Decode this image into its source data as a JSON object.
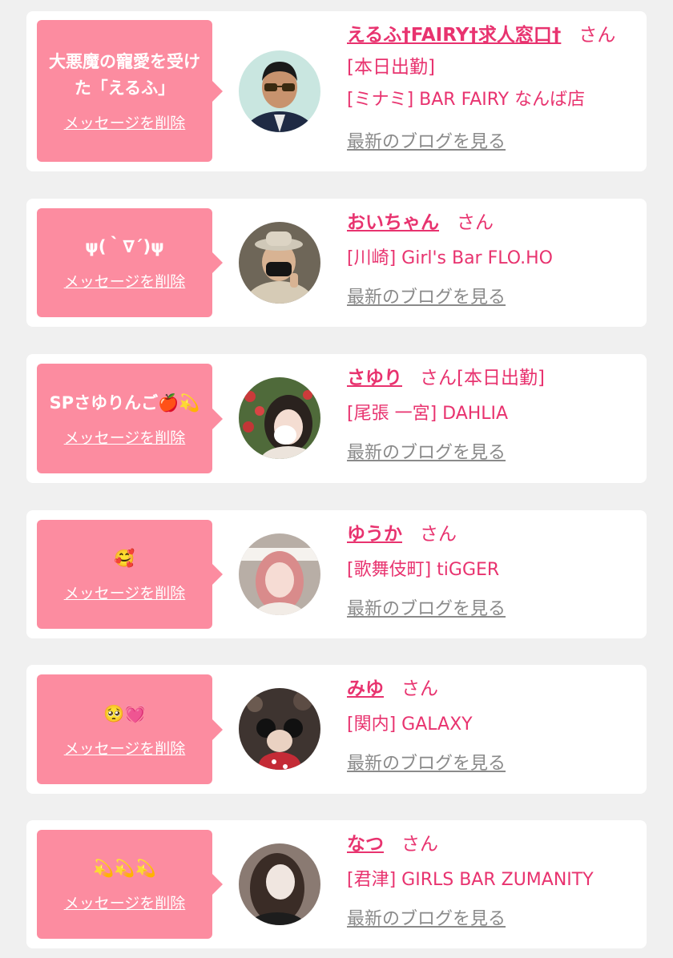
{
  "cards": [
    {
      "message": "大悪魔の寵愛を受けた「えるふ」",
      "delete_label": "メッセージを削除",
      "name": "えるふ†FAIRY†求人窓口†",
      "suffix": "さん[本日出勤]",
      "shop": "[ミナミ] BAR FAIRY なんば店",
      "blog_label": "最新のブログを見る",
      "avatar_icon": "avatar-man-sunglasses"
    },
    {
      "message": "ψ(｀∇´)ψ",
      "delete_label": "メッセージを削除",
      "name": "おいちゃん",
      "suffix": "さん",
      "shop": "[川崎] Girl's Bar FLO.HO",
      "blog_label": "最新のブログを見る",
      "avatar_icon": "avatar-person-hat-mask"
    },
    {
      "message": "SPさゆりんご🍎💫",
      "delete_label": "メッセージを削除",
      "name": "さゆり",
      "suffix": "さん[本日出勤]",
      "shop": "[尾張 一宮] DAHLIA",
      "blog_label": "最新のブログを見る",
      "avatar_icon": "avatar-girl-strawberries"
    },
    {
      "message": "🥰",
      "delete_label": "メッセージを削除",
      "name": "ゆうか",
      "suffix": "さん",
      "shop": "[歌舞伎町] tiGGER",
      "blog_label": "最新のブログを見る",
      "avatar_icon": "avatar-girl-pink-hair"
    },
    {
      "message": "🥺💓",
      "delete_label": "メッセージを削除",
      "name": "みゆ",
      "suffix": "さん",
      "shop": "[関内] GALAXY",
      "blog_label": "最新のブログを見る",
      "avatar_icon": "avatar-minnie-crowd"
    },
    {
      "message": "💫💫💫",
      "delete_label": "メッセージを削除",
      "name": "なつ",
      "suffix": "さん",
      "shop": "[君津] GIRLS BAR ZUMANITY",
      "blog_label": "最新のブログを見る",
      "avatar_icon": "avatar-girl-dark"
    }
  ],
  "colors": {
    "accent": "#e8336f",
    "bubble": "#fc8ca0",
    "link_gray": "#8a8a8a",
    "background": "#f0f0f0"
  }
}
